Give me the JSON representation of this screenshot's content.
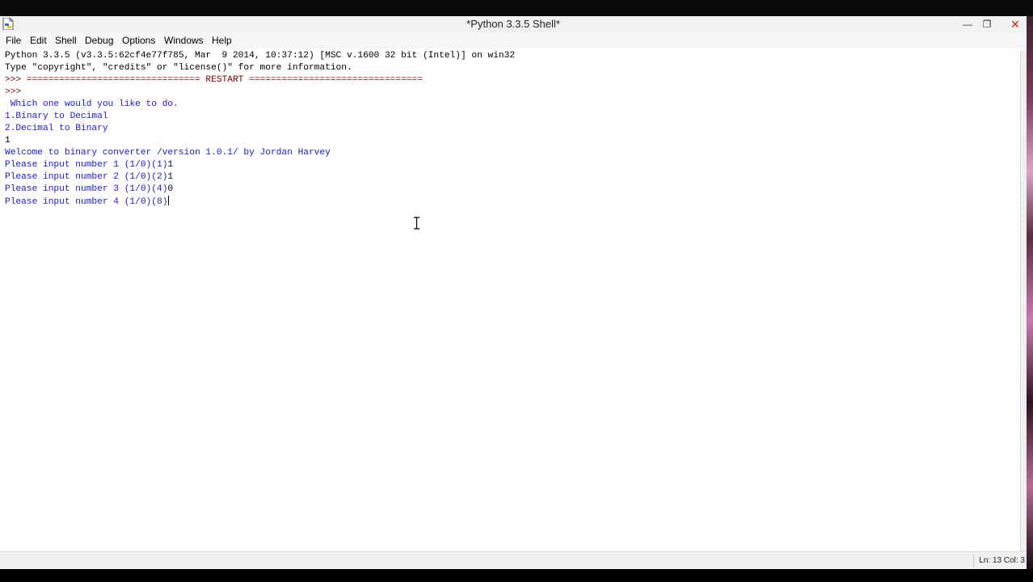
{
  "window": {
    "title": "*Python 3.3.5 Shell*",
    "controls": {
      "minimize": "—",
      "maximize": "❐",
      "close": "✕"
    }
  },
  "menu": [
    "File",
    "Edit",
    "Shell",
    "Debug",
    "Options",
    "Windows",
    "Help"
  ],
  "shell": {
    "lines": [
      {
        "text": "Python 3.3.5 (v3.3.5:62cf4e77f785, Mar  9 2014, 10:37:12) [MSC v.1600 32 bit (Intel)] on win32",
        "color": "black"
      },
      {
        "text": "Type \"copyright\", \"credits\" or \"license()\" for more information.",
        "color": "black"
      },
      {
        "text": ">>> ================================ RESTART ================================",
        "color": "maroon"
      },
      {
        "text": ">>> ",
        "color": "maroon"
      },
      {
        "text": " Which one would you like to do.",
        "color": "blue"
      },
      {
        "text": "1.Binary to Decimal",
        "color": "blue"
      },
      {
        "text": "2.Decimal to Binary",
        "color": "blue"
      },
      {
        "text": "1",
        "color": "black"
      },
      {
        "text": "Welcome to binary converter /version 1.0.1/ by Jordan Harvey",
        "color": "blue"
      },
      {
        "text": "Please input number 1 (1/0)(1)",
        "color": "blue",
        "input": "1"
      },
      {
        "text": "Please input number 2 (1/0)(2)",
        "color": "blue",
        "input": "1"
      },
      {
        "text": "Please input number 3 (1/0)(4)",
        "color": "blue",
        "input": "0"
      },
      {
        "text": "Please input number 4 (1/0)(8)",
        "color": "blue",
        "input": "",
        "cursor": true
      }
    ]
  },
  "status": {
    "position": "Ln: 13 Col: 3"
  },
  "colors": {
    "prompt": "#800000",
    "output": "#1a1acd",
    "input": "#000000"
  }
}
